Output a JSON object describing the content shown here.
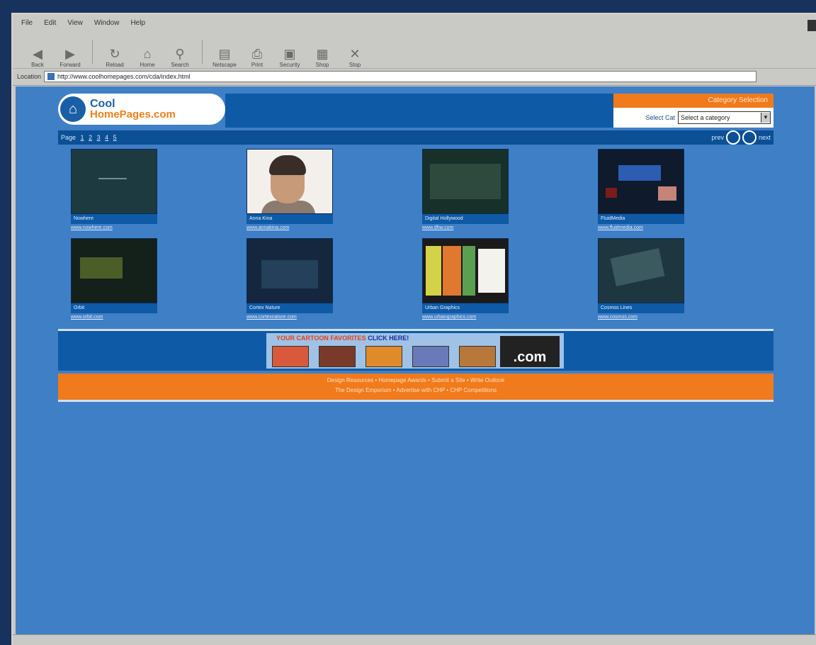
{
  "browser": {
    "menu": [
      "File",
      "Edit",
      "View",
      "Window",
      "Help"
    ],
    "toolbar": [
      {
        "label": "Back",
        "icon": "back-arrow-icon"
      },
      {
        "label": "Forward",
        "icon": "forward-arrow-icon"
      },
      {
        "label": "Reload",
        "icon": "reload-icon"
      },
      {
        "label": "Home",
        "icon": "home-icon"
      },
      {
        "label": "Search",
        "icon": "search-icon"
      },
      {
        "label": "Netscape",
        "icon": "netscape-icon"
      },
      {
        "label": "Print",
        "icon": "print-icon"
      },
      {
        "label": "Security",
        "icon": "lock-icon"
      },
      {
        "label": "Shop",
        "icon": "shop-icon"
      },
      {
        "label": "Stop",
        "icon": "stop-icon"
      }
    ],
    "address_label": "Location",
    "url": "http://www.coolhomepages.com/cda/index.html"
  },
  "site": {
    "logo_line1": "Cool",
    "logo_line2": "HomePages.com",
    "category_title": "Category Selection",
    "category_label": "Select Cat",
    "category_value": "Select a category",
    "pager_label": "Page",
    "pages": [
      "1",
      "2",
      "3",
      "4",
      "5"
    ],
    "prev_label": "prev",
    "next_label": "next",
    "sites": [
      {
        "title": "Nowhere",
        "url": "www.nowhere.com"
      },
      {
        "title": "Anna Kina",
        "url": "www.annakina.com"
      },
      {
        "title": "Digital Hollywood",
        "url": "www.dhw.com"
      },
      {
        "title": "FluidMedia",
        "url": "www.fluidmedia.com"
      },
      {
        "title": "Orbit",
        "url": "www.orbit.com"
      },
      {
        "title": "Cortex Nature",
        "url": "www.cortexnature.com"
      },
      {
        "title": "Urban Graphics",
        "url": "www.urbangraphics.com"
      },
      {
        "title": "Cosmos Lines",
        "url": "www.cosmos.com"
      }
    ],
    "ad_text": "YOUR CARTOON FAVORITES",
    "ad_click": "CLICK HERE!",
    "ad_dotcom": ".com",
    "footer_line1": "Design Resources  •  Homepage Awards  •  Submit a Site  •  Write Outlook",
    "footer_line2": "The Design Emporium  •  Advertise with CHP  •  CHP Competitions"
  },
  "colors": {
    "page_bg": "#3f7fc6",
    "header_blue": "#0e5aa6",
    "accent_orange": "#f07a1c"
  }
}
